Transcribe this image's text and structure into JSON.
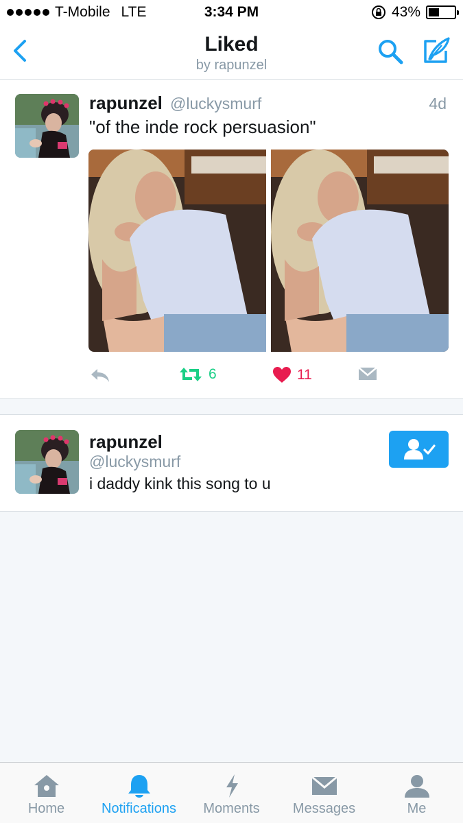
{
  "status_bar": {
    "carrier": "T-Mobile",
    "network": "LTE",
    "time": "3:34 PM",
    "battery": "43%",
    "battery_level": 0.43
  },
  "header": {
    "title": "Liked",
    "subtitle": "by rapunzel",
    "accent_color": "#1da1f2"
  },
  "tweet": {
    "name": "rapunzel",
    "handle": "@luckysmurf",
    "time": "4d",
    "text": "\"of the inde rock persuasion\"",
    "retweets": "6",
    "likes": "11"
  },
  "user_card": {
    "name": "rapunzel",
    "handle": "@luckysmurf",
    "bio": "i daddy kink this song to u"
  },
  "tabs": [
    {
      "label": "Home",
      "icon": "home-icon"
    },
    {
      "label": "Notifications",
      "icon": "bell-icon",
      "active": true
    },
    {
      "label": "Moments",
      "icon": "lightning-icon"
    },
    {
      "label": "Messages",
      "icon": "envelope-icon"
    },
    {
      "label": "Me",
      "icon": "person-icon"
    }
  ]
}
